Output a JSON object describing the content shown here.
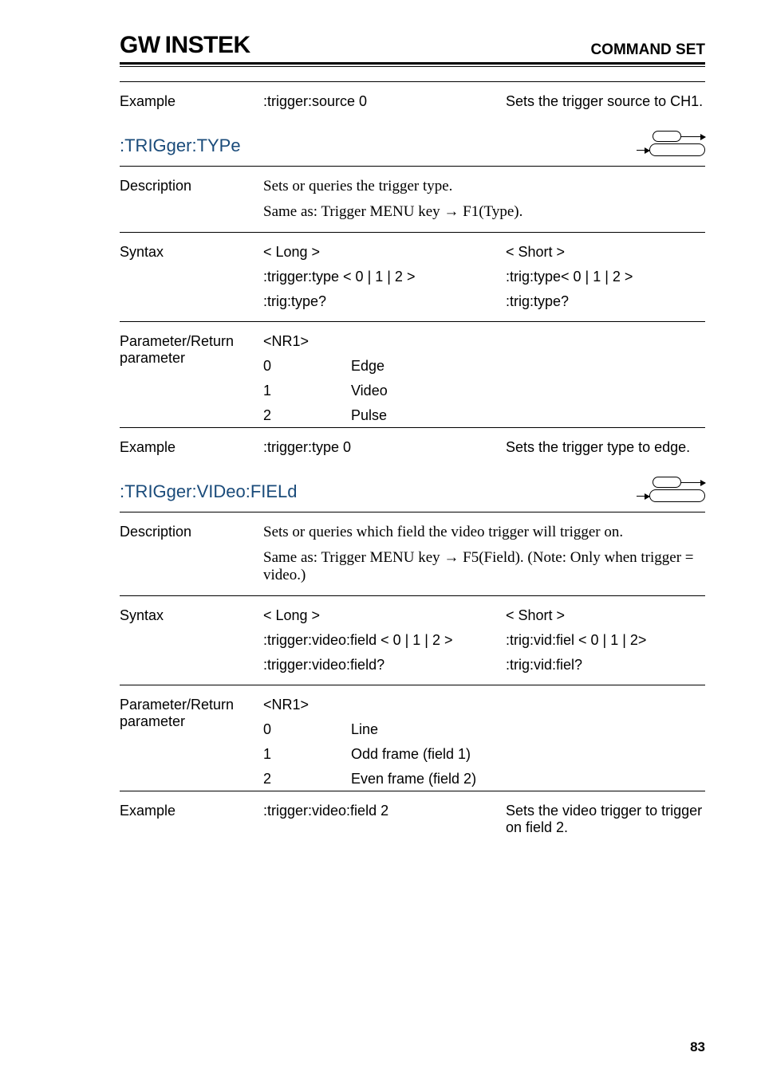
{
  "brand": {
    "part1": "GW",
    "part2": "INSTEK"
  },
  "page_title": "COMMAND SET",
  "block1": {
    "label": "Example",
    "cmd": ":trigger:source 0",
    "desc": "Sets the trigger source to CH1."
  },
  "sec1": {
    "title": ":TRIGger:TYPe",
    "desc_label": "Description",
    "desc1": "Sets or queries the trigger type.",
    "desc2": "Same as: Trigger MENU key → F1(Type).",
    "syntax_label": "Syntax",
    "long_h": "< Long >",
    "short_h": "< Short >",
    "long1": ":trigger:type < 0 | 1 | 2 >",
    "short1": ":trig:type< 0 | 1 | 2 >",
    "long2": ":trig:type?",
    "short2": ":trig:type?",
    "param_label1": "Parameter/Return",
    "param_label2": "parameter",
    "nr1": "<NR1>",
    "p0v": "0",
    "p0d": "Edge",
    "p1v": "1",
    "p1d": "Video",
    "p2v": "2",
    "p2d": "Pulse",
    "ex_label": "Example",
    "ex_cmd": ":trigger:type 0",
    "ex_desc": "Sets the trigger type to edge."
  },
  "sec2": {
    "title": ":TRIGger:VIDeo:FIELd",
    "desc_label": "Description",
    "desc1": "Sets or queries which field the video trigger will trigger on.",
    "desc2": "Same as: Trigger MENU key → F5(Field). (Note: Only when trigger = video.)",
    "syntax_label": "Syntax",
    "long_h": "< Long >",
    "short_h": "< Short >",
    "long1": ":trigger:video:field < 0 | 1 | 2 >",
    "short1": ":trig:vid:fiel < 0 | 1 | 2>",
    "long2": ":trigger:video:field?",
    "short2": ":trig:vid:fiel?",
    "param_label1": "Parameter/Return",
    "param_label2": "parameter",
    "nr1": "<NR1>",
    "p0v": "0",
    "p0d": "Line",
    "p1v": "1",
    "p1d": "Odd frame (field 1)",
    "p2v": "2",
    "p2d": "Even frame (field 2)",
    "ex_label": "Example",
    "ex_cmd": ":trigger:video:field 2",
    "ex_desc": "Sets the video trigger to trigger on field 2."
  },
  "page_number": "83"
}
